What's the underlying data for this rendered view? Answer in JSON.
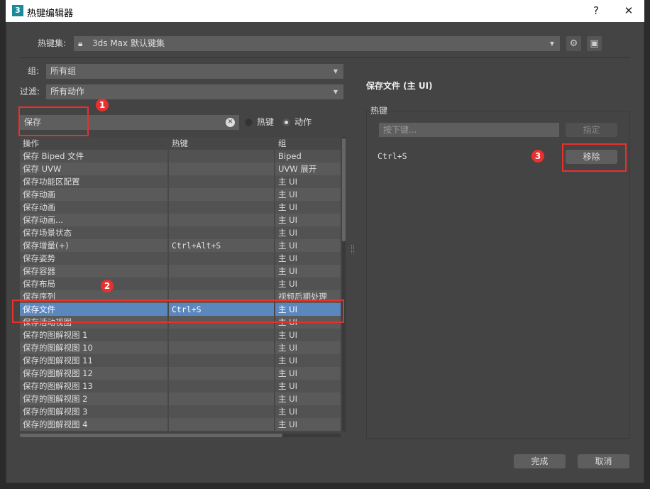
{
  "window": {
    "title": "热键编辑器",
    "app_icon_label": "3",
    "help_label": "?",
    "close_label": "✕"
  },
  "hotkey_set": {
    "label": "热键集:",
    "value": "3ds Max 默认键集",
    "locked": true
  },
  "filters": {
    "group_label": "组:",
    "group_value": "所有组",
    "filter_label": "过滤:",
    "filter_value": "所有动作"
  },
  "search": {
    "value": "保存",
    "radio_hotkey": "热键",
    "radio_action": "动作",
    "selected_mode": "动作"
  },
  "table": {
    "columns": [
      "操作",
      "热键",
      "组"
    ],
    "rows": [
      [
        "保存 Biped 文件",
        "",
        "Biped"
      ],
      [
        "保存 UVW",
        "",
        "UVW 展开"
      ],
      [
        "保存功能区配置",
        "",
        "主 UI"
      ],
      [
        "保存动画",
        "",
        "主 UI"
      ],
      [
        "保存动画",
        "",
        "主 UI"
      ],
      [
        "保存动画...",
        "",
        "主 UI"
      ],
      [
        "保存场景状态",
        "",
        "主 UI"
      ],
      [
        "保存增量(+)",
        "Ctrl+Alt+S",
        "主 UI"
      ],
      [
        "保存姿势",
        "",
        "主 UI"
      ],
      [
        "保存容器",
        "",
        "主 UI"
      ],
      [
        "保存布局",
        "",
        "主 UI"
      ],
      [
        "保存序列",
        "",
        "视频后期处理"
      ],
      [
        "保存文件",
        "Ctrl+S",
        "主 UI"
      ],
      [
        "保存活动视图",
        "",
        "主 UI"
      ],
      [
        "保存的图解视图 1",
        "",
        "主 UI"
      ],
      [
        "保存的图解视图 10",
        "",
        "主 UI"
      ],
      [
        "保存的图解视图 11",
        "",
        "主 UI"
      ],
      [
        "保存的图解视图 12",
        "",
        "主 UI"
      ],
      [
        "保存的图解视图 13",
        "",
        "主 UI"
      ],
      [
        "保存的图解视图 2",
        "",
        "主 UI"
      ],
      [
        "保存的图解视图 3",
        "",
        "主 UI"
      ],
      [
        "保存的图解视图 4",
        "",
        "主 UI"
      ]
    ],
    "selected_index": 12
  },
  "detail": {
    "title": "保存文件 (主 UI)",
    "group_title": "热键",
    "key_placeholder": "按下键...",
    "assign_label": "指定",
    "current_hotkey": "Ctrl+S",
    "remove_label": "移除"
  },
  "footer": {
    "done_label": "完成",
    "cancel_label": "取消"
  },
  "annotations": [
    "1",
    "2",
    "3"
  ],
  "colors": {
    "selection": "#5b87bf",
    "annotation": "#e8302e"
  }
}
